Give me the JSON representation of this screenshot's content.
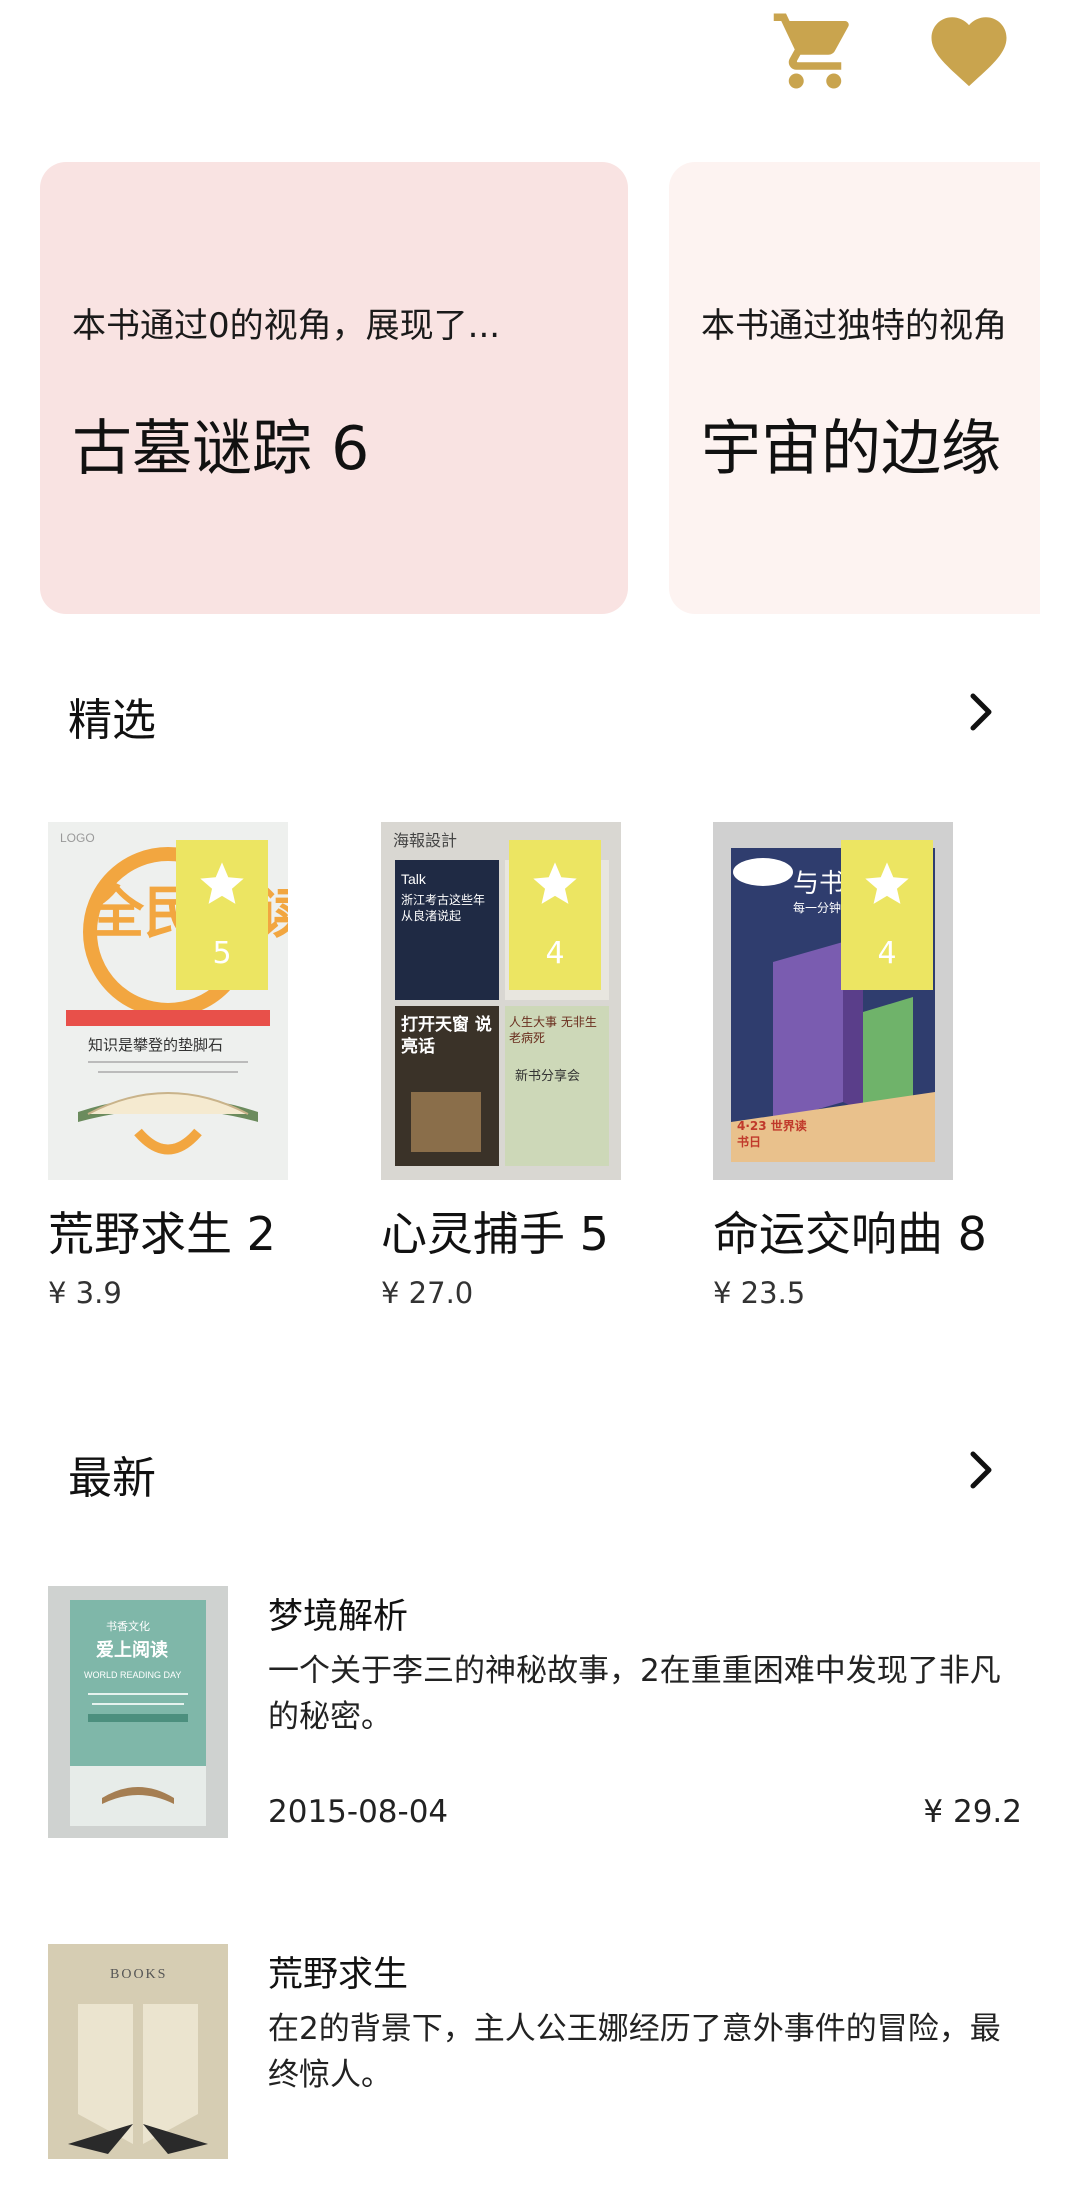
{
  "header": {
    "icons": [
      "cart-icon",
      "heart-icon"
    ],
    "accent_color": "#c9a44e"
  },
  "banners": [
    {
      "description": "本书通过0的视角，展现了...",
      "title": "古墓谜踪 6",
      "bg": "#f9e3e2"
    },
    {
      "description": "本书通过独特的视角",
      "title": "宇宙的边缘",
      "bg": "#fdf3f1"
    }
  ],
  "featured": {
    "title": "精选",
    "books": [
      {
        "title": "荒野求生 2",
        "price": "¥ 3.9",
        "rating": "5"
      },
      {
        "title": "心灵捕手 5",
        "price": "¥ 27.0",
        "rating": "4"
      },
      {
        "title": "命运交响曲 8",
        "price": "¥ 23.5",
        "rating": "4"
      }
    ],
    "covers": [
      {
        "text_main": "全民阅读",
        "text_sub": "知识是攀登的垫脚石",
        "logo": "LOGO"
      },
      {
        "text_top": "海報設計",
        "text_a": "Talk",
        "text_b": "浙江考古这些年 从良渚说起",
        "text_c": "打开天窗 说亮话",
        "text_d": "人生大事 无非生老病死",
        "text_e": "新书分享会"
      },
      {
        "text_main": "与书",
        "text_sub": "每一分钟都是最好的",
        "text_day": "4·23 世界读书日"
      }
    ]
  },
  "latest": {
    "title": "最新",
    "items": [
      {
        "title": "梦境解析",
        "description": "一个关于李三的神秘故事，2在重重困难中发现了非凡的秘密。",
        "date": "2015-08-04",
        "price": "¥ 29.2",
        "cover_text": "爱上阅读",
        "cover_sub": "WORLD READING DAY",
        "cover_top": "书香文化"
      },
      {
        "title": "荒野求生",
        "description": "在2的背景下，主人公王娜经历了意外事件的冒险，最终惊人。",
        "cover_text": "BOOKS"
      }
    ]
  }
}
